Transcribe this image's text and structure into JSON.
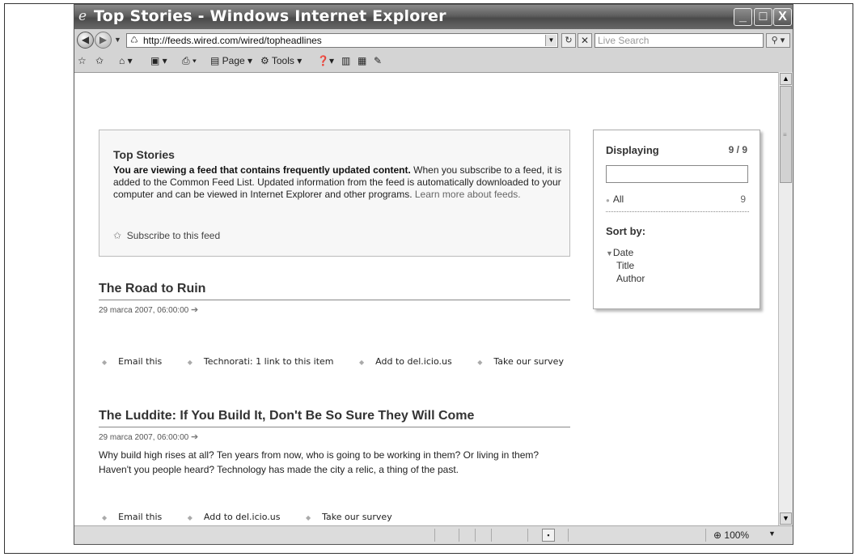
{
  "window": {
    "title": "Top Stories - Windows Internet Explorer",
    "min_label": "_",
    "max_label": "□",
    "close_label": "X"
  },
  "address_bar": {
    "url": "http://feeds.wired.com/wired/topheadlines",
    "search_placeholder": "Live Search"
  },
  "command_bar": {
    "page_label": "Page",
    "tools_label": "Tools"
  },
  "feed_info": {
    "heading": "Top Stories",
    "bold_text": "You are viewing a feed that contains frequently updated content.",
    "text": " When you subscribe to a feed, it is added to the Common Feed List. Updated information from the feed is automatically downloaded to your computer and can be viewed in Internet Explorer and other programs. ",
    "learn_more": "Learn more about feeds.",
    "subscribe": "Subscribe to this feed"
  },
  "sidebar": {
    "displaying_label": "Displaying",
    "count": "9 / 9",
    "all_label": "All",
    "all_count": "9",
    "sort_label": "Sort by:",
    "sort_options": [
      "Date",
      "Title",
      "Author"
    ]
  },
  "articles": [
    {
      "title": "The Road to Ruin",
      "date": "29 marca 2007, 06:00:00",
      "body": "",
      "actions": [
        "Email this",
        "Technorati: 1 link to this item",
        "Add to del.icio.us",
        "Take our survey"
      ]
    },
    {
      "title": "The Luddite: If You Build It, Don't Be So Sure They Will Come",
      "date": "29 marca 2007, 06:00:00",
      "body": "Why build high rises at all? Ten years from now, who is going to be working in them? Or living in them? Haven't you people heard? Technology has made the city a relic, a thing of the past.",
      "actions": [
        "Email this",
        "Add to del.icio.us",
        "Take our survey"
      ]
    }
  ],
  "status_bar": {
    "zoom": "100%"
  }
}
